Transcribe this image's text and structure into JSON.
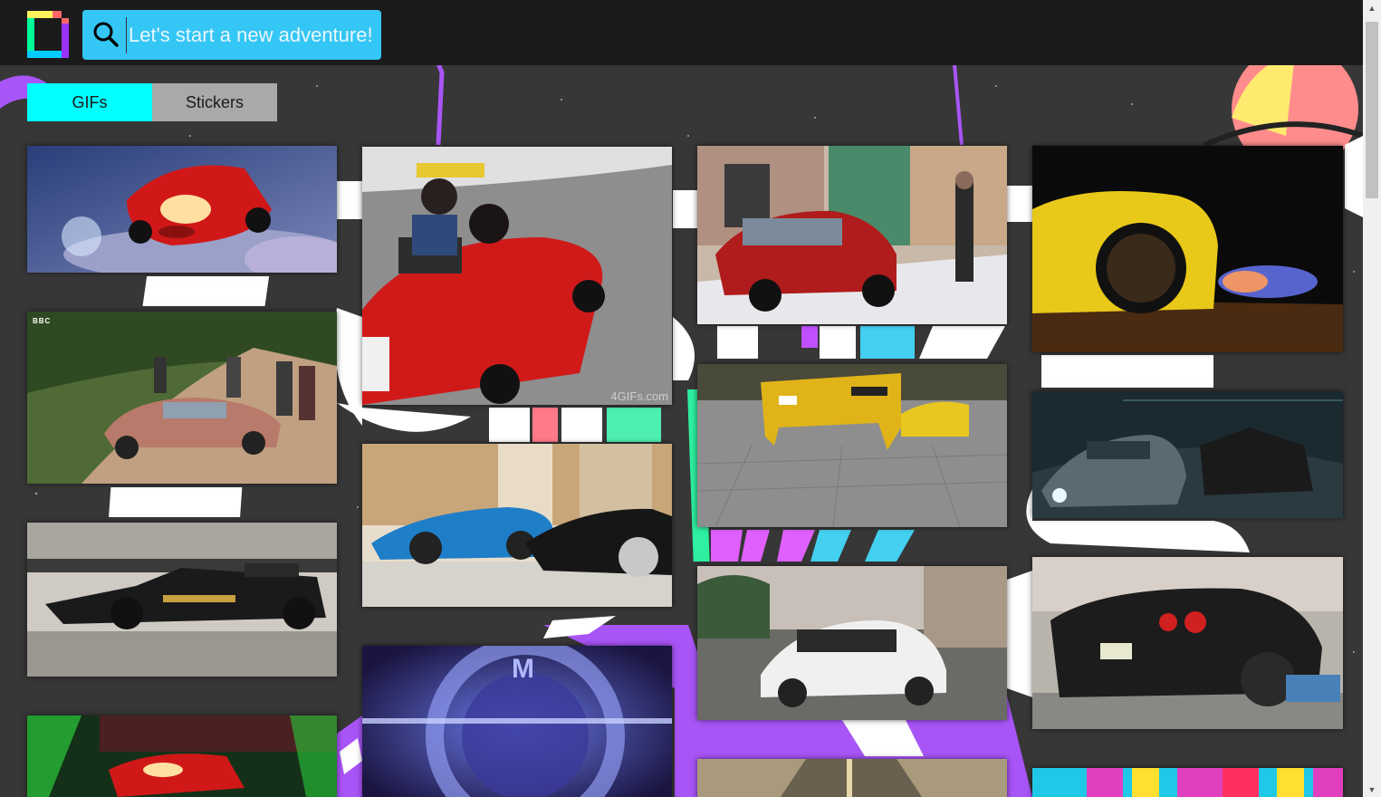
{
  "search": {
    "placeholder": "Let's start a new adventure!",
    "value": ""
  },
  "tabs": [
    {
      "label": "GIFs",
      "active": true
    },
    {
      "label": "Stickers",
      "active": false
    }
  ],
  "tiles": [
    {
      "name": "gif-lightning-mcqueen-stadium"
    },
    {
      "name": "gif-bbc-pushing-car",
      "badge": "BBC"
    },
    {
      "name": "gif-f1-race-car"
    },
    {
      "name": "gif-lightning-mcqueen-neon"
    },
    {
      "name": "gif-kids-red-toy-car",
      "caption": "4GIFs.com"
    },
    {
      "name": "gif-blue-supercar-black-car"
    },
    {
      "name": "gif-bmw-m-logo",
      "caption": "M Power"
    },
    {
      "name": "gif-red-sedan-snow"
    },
    {
      "name": "gif-yellow-car-barrier"
    },
    {
      "name": "gif-white-lamborghini"
    },
    {
      "name": "gif-road-bottom"
    },
    {
      "name": "gif-yellow-car-exhaust-flames"
    },
    {
      "name": "gif-tunnel-chase"
    },
    {
      "name": "gif-black-gtr-dyno"
    },
    {
      "name": "gif-colorful-bottom"
    }
  ],
  "colors": {
    "accent": "#00ffff",
    "search_bg": "#34c6f4",
    "tab_inactive": "#a9a9a9",
    "topbar": "#1b1b1b"
  }
}
